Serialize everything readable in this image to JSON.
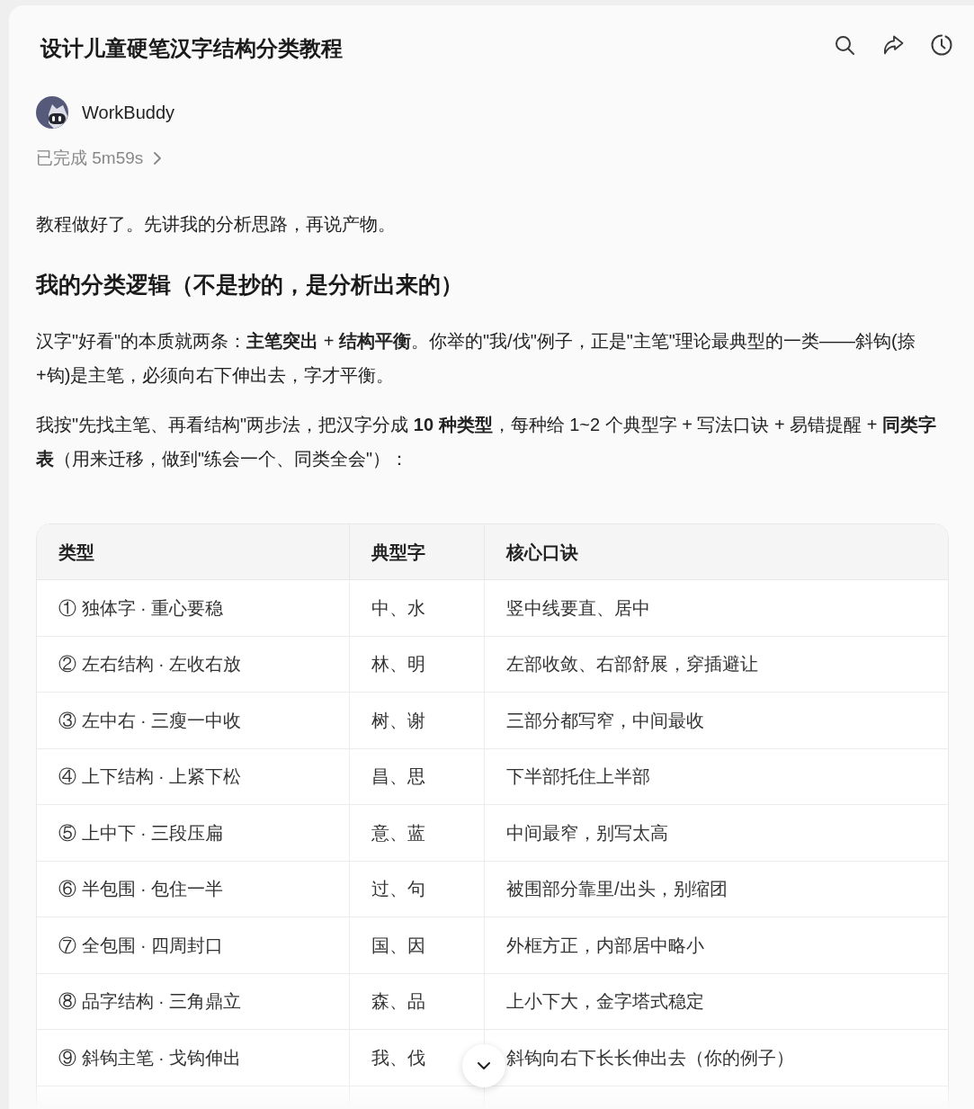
{
  "header": {
    "title": "设计儿童硬笔汉字结构分类教程"
  },
  "message": {
    "author": "WorkBuddy",
    "status": "已完成 5m59s",
    "intro": "教程做好了。先讲我的分析思路，再说产物。",
    "heading": "我的分类逻辑（不是抄的，是分析出来的）",
    "paragraphs": [
      "汉字\"好看\"的本质就两条：**主笔突出** + **结构平衡**。你举的\"我/伐\"例子，正是\"主笔\"理论最典型的一类——斜钩(捺+钩)是主笔，必须向右下伸出去，字才平衡。",
      "我按\"先找主笔、再看结构\"两步法，把汉字分成 **10 种类型**，每种给 1~2 个典型字 + 写法口诀 + 易错提醒 + **同类字表**（用来迁移，做到\"练会一个、同类全会\"）："
    ]
  },
  "table": {
    "columns": [
      "类型",
      "典型字",
      "核心口诀"
    ],
    "rows": [
      [
        "① 独体字 · 重心要稳",
        "中、水",
        "竖中线要直、居中"
      ],
      [
        "② 左右结构 · 左收右放",
        "林、明",
        "左部收敛、右部舒展，穿插避让"
      ],
      [
        "③ 左中右 · 三瘦一中收",
        "树、谢",
        "三部分都写窄，中间最收"
      ],
      [
        "④ 上下结构 · 上紧下松",
        "昌、思",
        "下半部托住上半部"
      ],
      [
        "⑤ 上中下 · 三段压扁",
        "意、蓝",
        "中间最窄，别写太高"
      ],
      [
        "⑥ 半包围 · 包住一半",
        "过、句",
        "被围部分靠里/出头，别缩团"
      ],
      [
        "⑦ 全包围 · 四周封口",
        "国、因",
        "外框方正，内部居中略小"
      ],
      [
        "⑧ 品字结构 · 三角鼎立",
        "森、品",
        "上小下大，金字塔式稳定"
      ],
      [
        "⑨ 斜钩主笔 · 戈钩伸出",
        "我、伐",
        "斜钩向右下长长伸出去（你的例子）"
      ]
    ]
  }
}
